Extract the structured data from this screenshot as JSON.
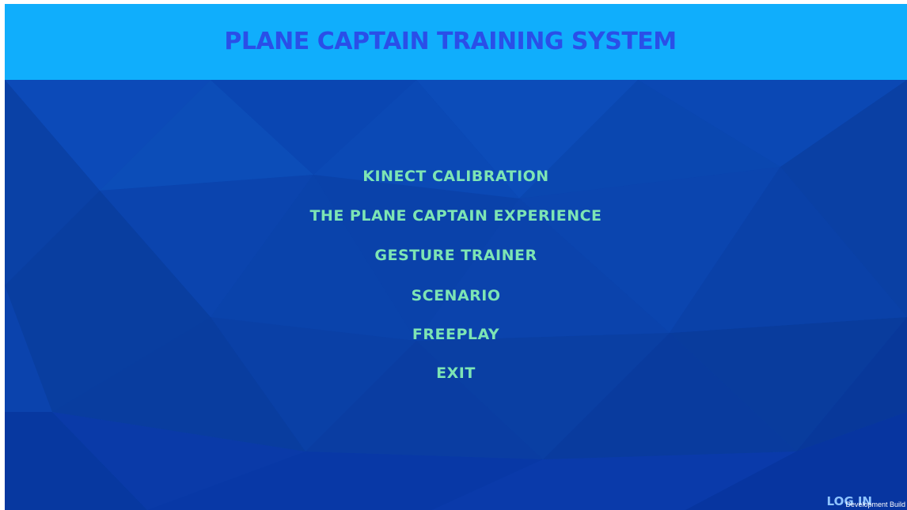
{
  "header": {
    "title": "PLANE CAPTAIN TRAINING SYSTEM"
  },
  "menu": {
    "items": [
      {
        "id": "kinect-calibration",
        "label": "KINECT CALIBRATION"
      },
      {
        "id": "plane-captain-experience",
        "label": "THE PLANE CAPTAIN EXPERIENCE"
      },
      {
        "id": "gesture-trainer",
        "label": "GESTURE TRAINER"
      },
      {
        "id": "scenario",
        "label": "SCENARIO"
      },
      {
        "id": "freeplay",
        "label": "FREEPLAY"
      },
      {
        "id": "exit",
        "label": "EXIT"
      }
    ]
  },
  "footer": {
    "login_label": "LOG IN",
    "dev_build_label": "Development Build"
  },
  "colors": {
    "header_bg": "#10aefc",
    "title": "#2a4fe8",
    "menu_text": "#7de5b4",
    "background": "#0b3fa8"
  }
}
